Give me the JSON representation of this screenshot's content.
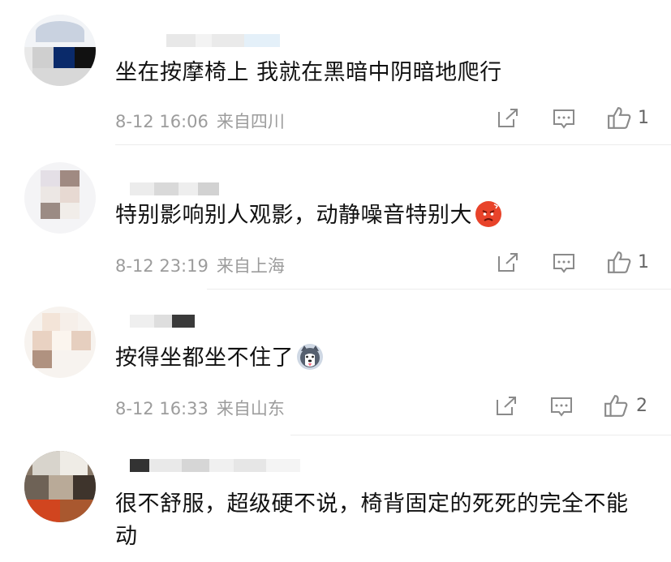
{
  "comments": [
    {
      "text": "坐在按摩椅上 我就在黑暗中阴暗地爬行",
      "date": "8-12 16:06",
      "location": "来自四川",
      "likes": "1"
    },
    {
      "text": "特别影响别人观影，动静噪音特别大",
      "emoji": "angry-face-emoji",
      "date": "8-12 23:19",
      "location": "来自上海",
      "likes": "1"
    },
    {
      "text": "按得坐都坐不住了",
      "emoji": "husky-dog-emoji",
      "date": "8-12 16:33",
      "location": "来自山东",
      "likes": "2"
    },
    {
      "text": "很不舒服，超级硬不说，椅背固定的死死的完全不能动"
    }
  ],
  "colors": {
    "text": "#111111",
    "meta": "#9c9c9c",
    "icon": "#8a8a8a",
    "divider": "#ececec"
  }
}
